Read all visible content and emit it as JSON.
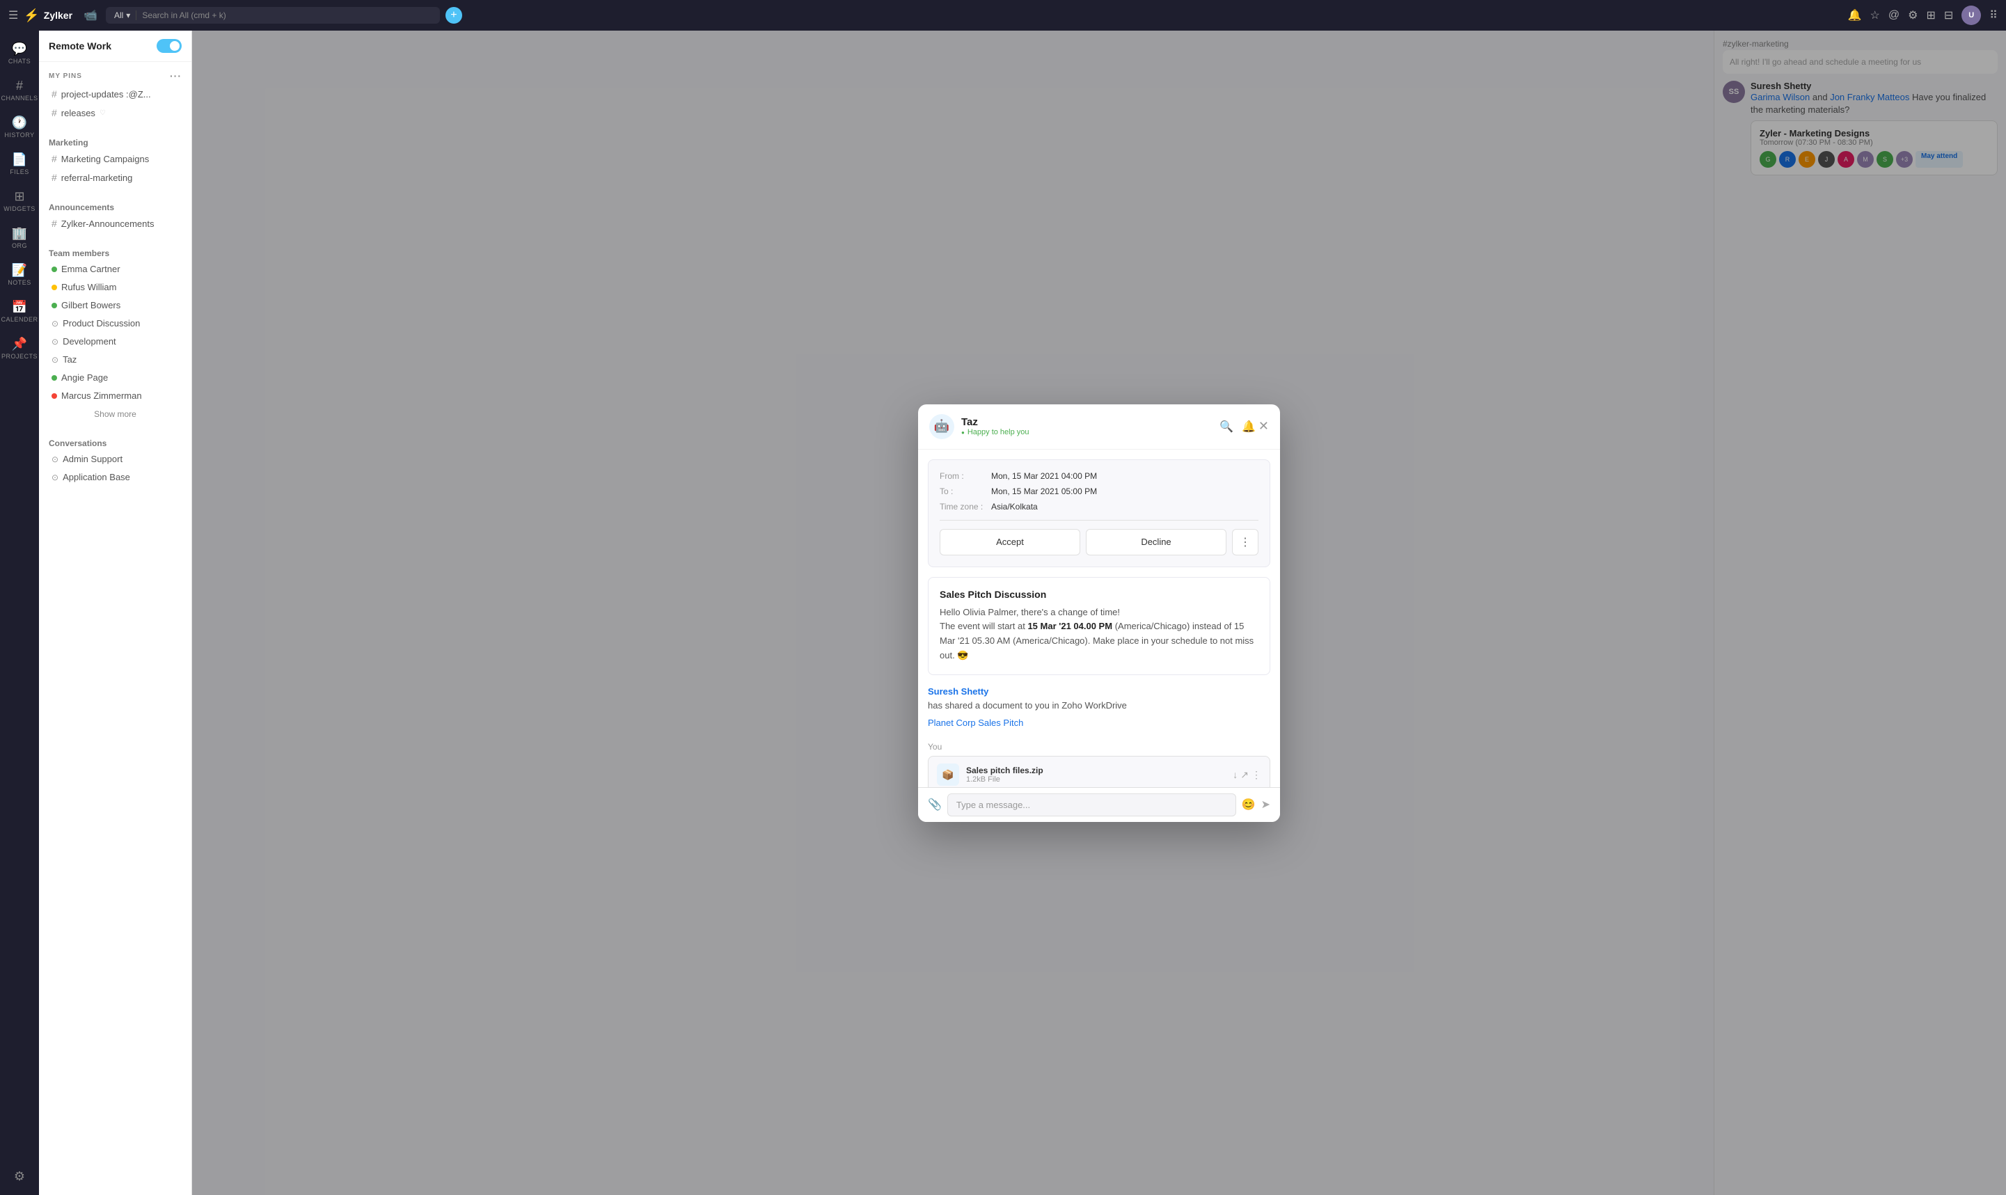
{
  "app": {
    "name": "Zylker",
    "logo_icon": "⚡"
  },
  "topbar": {
    "menu_icon": "☰",
    "video_icon": "📹",
    "search_placeholder": "Search in All (cmd + k)",
    "search_dropdown": "All",
    "add_button": "+",
    "workspace": "Remote Work"
  },
  "nav_icons": [
    {
      "id": "chats",
      "icon": "💬",
      "label": "CHATS",
      "active": false
    },
    {
      "id": "channels",
      "icon": "#",
      "label": "CHANNELS",
      "active": false
    },
    {
      "id": "history",
      "icon": "🕐",
      "label": "HISTORY",
      "active": false
    },
    {
      "id": "files",
      "icon": "📄",
      "label": "FILES",
      "active": false
    },
    {
      "id": "widgets",
      "icon": "⊞",
      "label": "WIDGETS",
      "active": false
    },
    {
      "id": "org",
      "icon": "🏢",
      "label": "ORG",
      "active": false
    },
    {
      "id": "notes",
      "icon": "📝",
      "label": "NOTES",
      "active": false
    },
    {
      "id": "calender",
      "icon": "📅",
      "label": "CALENDER",
      "active": false
    },
    {
      "id": "projects",
      "icon": "📌",
      "label": "PROJECTS",
      "active": false
    }
  ],
  "sidebar": {
    "section_my_pins": "My Pins",
    "pins": [
      {
        "name": "project-updates :@Z...",
        "hash": true
      },
      {
        "name": "releases",
        "hash": true,
        "heart": true
      }
    ],
    "section_marketing": "Marketing",
    "marketing_channels": [
      {
        "name": "Marketing Campaigns"
      },
      {
        "name": "referral-marketing"
      }
    ],
    "section_announcements": "Announcements",
    "announcements": [
      {
        "name": "Zylker-Announcements"
      }
    ],
    "section_team_members": "Team members",
    "team_members": [
      {
        "name": "Emma Cartner",
        "status": "green"
      },
      {
        "name": "Rufus William",
        "status": "yellow"
      },
      {
        "name": "Gilbert Bowers",
        "status": "green"
      },
      {
        "name": "Product Discussion",
        "status": "icon"
      },
      {
        "name": "Development",
        "status": "icon"
      },
      {
        "name": "Taz",
        "status": "icon"
      },
      {
        "name": "Angie Page",
        "status": "green"
      },
      {
        "name": "Marcus Zimmerman",
        "status": "red"
      }
    ],
    "show_more": "Show more",
    "section_conversations": "Conversations",
    "conversations": [
      {
        "name": "Admin Support"
      },
      {
        "name": "Application Base"
      }
    ]
  },
  "modal": {
    "bot_name": "Taz",
    "bot_status": "Happy to help you",
    "bot_avatar": "🤖",
    "meeting_from_label": "From :",
    "meeting_from_value": "Mon, 15 Mar 2021 04:00 PM",
    "meeting_to_label": "To :",
    "meeting_to_value": "Mon, 15 Mar 2021 05:00 PM",
    "meeting_tz_label": "Time zone :",
    "meeting_tz_value": "Asia/Kolkata",
    "btn_accept": "Accept",
    "btn_decline": "Decline",
    "btn_more": "⋮",
    "sales_pitch_title": "Sales Pitch Discussion",
    "sales_pitch_text_1": "Hello Olivia Palmer, there's a change of time!",
    "sales_pitch_text_2": "The event will start at",
    "sales_pitch_bold": "15 Mar '21 04.00 PM",
    "sales_pitch_text_3": "(America/Chicago)",
    "sales_pitch_text_4": "instead of 15 Mar '21 05.30 AM (America/Chicago). Make place in your schedule to not miss out.",
    "sales_pitch_emoji": "😎",
    "doc_share_text": "Suresh Shetty has shared a document to you in Zoho WorkDrive",
    "doc_share_link": "Planet Corp Sales Pitch",
    "doc_share_author": "Suresh Shetty",
    "you_label": "You",
    "file_name": "Sales pitch files.zip",
    "file_size": "1.2kB File"
  },
  "right_panel": {
    "channel_name": "#zylker-marketing",
    "msg1_sender": "Suresh Shetty",
    "msg1_text": "and",
    "msg1_highlight1": "Garima Wilson",
    "msg1_highlight2": "Jon Franky Matteos",
    "msg1_text2": "Have you finalized the marketing materials?",
    "meeting_title": "Zyler - Marketing Designs",
    "meeting_time": "Tomorrow (07:30 PM - 08:30 PM)",
    "may_attend_label": "May attend",
    "system_msg": "All right! I'll go ahead and schedule a meeting for us"
  }
}
